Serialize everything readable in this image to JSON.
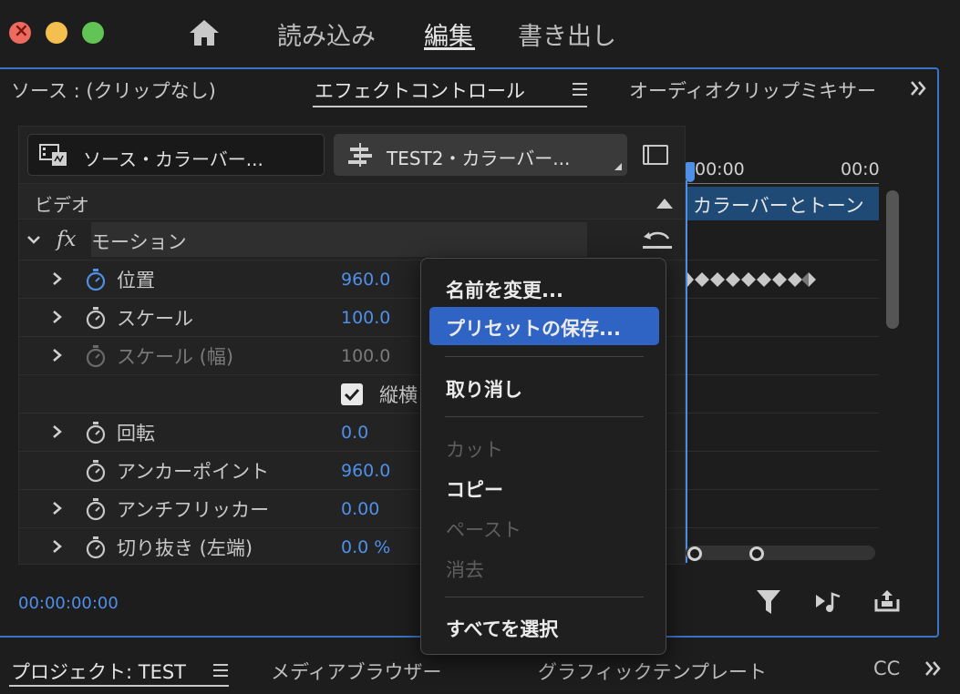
{
  "titlebar": {
    "workspaces": [
      "読み込み",
      "編集",
      "書き出し"
    ],
    "active_workspace": "編集"
  },
  "tabs": {
    "source": "ソース : (クリップなし)",
    "effect_controls": "エフェクトコントロール",
    "audio_mixer": "オーディオクリップミキサー"
  },
  "source_selector": "ソース・カラーバー...",
  "sequence_selector": "TEST2・カラーバー...",
  "video_section": "ビデオ",
  "effect": {
    "fx_label": "fx",
    "name": "モーション"
  },
  "properties": [
    {
      "name": "位置",
      "value": "960.0",
      "expandable": true,
      "disabled": false,
      "animated": true
    },
    {
      "name": "スケール",
      "value": "100.0",
      "expandable": true,
      "disabled": false,
      "animated": false
    },
    {
      "name": "スケール (幅)",
      "value": "100.0",
      "expandable": true,
      "disabled": true,
      "animated": false
    },
    {
      "name": "",
      "checkbox_label": "縦横",
      "checked": true
    },
    {
      "name": "回転",
      "value": "0.0",
      "expandable": true,
      "disabled": false,
      "animated": false
    },
    {
      "name": "アンカーポイント",
      "value": "960.0",
      "expandable": false,
      "disabled": false,
      "animated": false
    },
    {
      "name": "アンチフリッカー",
      "value": "0.00",
      "expandable": true,
      "disabled": false,
      "animated": false
    },
    {
      "name": "切り抜き (左端)",
      "value": "0.0 %",
      "expandable": true,
      "disabled": false,
      "animated": false
    }
  ],
  "timeline": {
    "ruler_labels": [
      "00:00",
      "00:0"
    ],
    "clip_label": "カラーバーとトーン"
  },
  "timecode": "00:00:00:00",
  "bottom_tabs": {
    "project": "プロジェクト: TEST",
    "media_browser": "メディアブラウザー",
    "graphic_templates": "グラフィックテンプレート",
    "cc": "CC"
  },
  "context_menu": {
    "items": [
      {
        "label": "名前を変更...",
        "enabled": true,
        "highlighted": false
      },
      {
        "label": "プリセットの保存...",
        "enabled": true,
        "highlighted": true
      },
      {
        "label": "取り消し",
        "enabled": true,
        "highlighted": false
      },
      {
        "label": "カット",
        "enabled": false,
        "highlighted": false
      },
      {
        "label": "コピー",
        "enabled": true,
        "highlighted": false
      },
      {
        "label": "ペースト",
        "enabled": false,
        "highlighted": false
      },
      {
        "label": "消去",
        "enabled": false,
        "highlighted": false
      },
      {
        "label": "すべてを選択",
        "enabled": true,
        "highlighted": false
      }
    ]
  },
  "colors": {
    "accent_blue": "#4f8fe8",
    "menu_highlight": "#2f63c4",
    "panel_border": "#3b73c8",
    "clip_bar": "#1e4a75"
  }
}
